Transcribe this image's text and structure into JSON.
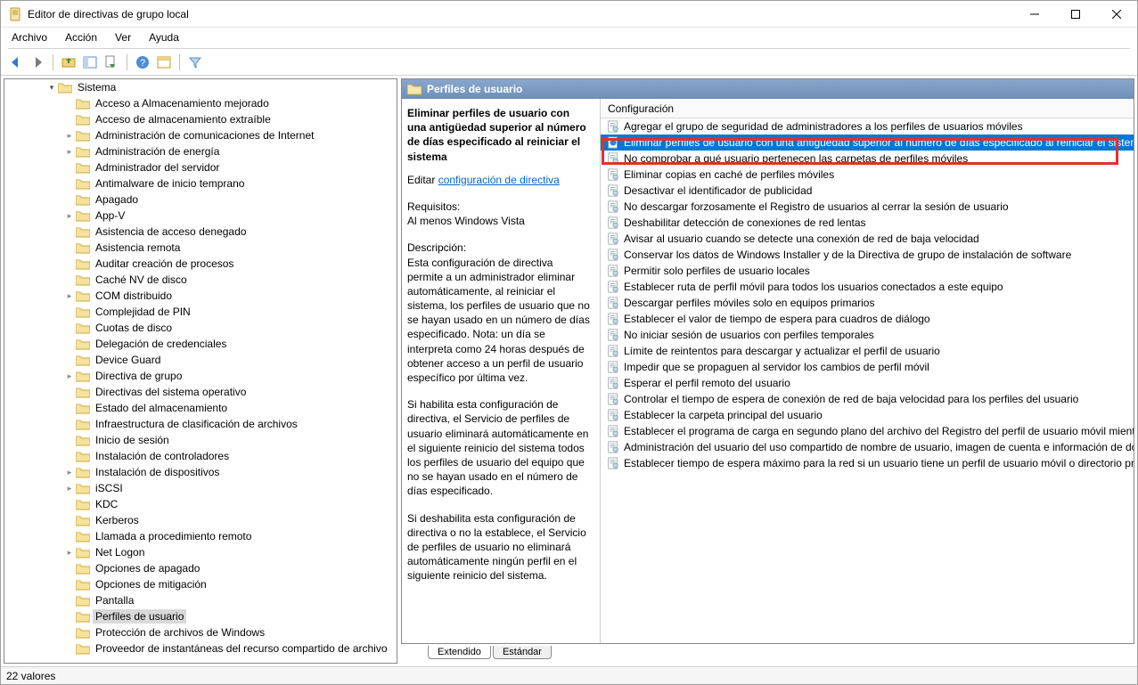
{
  "window": {
    "title": "Editor de directivas de grupo local"
  },
  "menus": [
    "Archivo",
    "Acción",
    "Ver",
    "Ayuda"
  ],
  "tree": {
    "root_label": "Sistema",
    "items": [
      {
        "label": "Acceso a Almacenamiento mejorado",
        "arrow": "none"
      },
      {
        "label": "Acceso de almacenamiento extraíble",
        "arrow": "none"
      },
      {
        "label": "Administración de comunicaciones de Internet",
        "arrow": "right"
      },
      {
        "label": "Administración de energía",
        "arrow": "right"
      },
      {
        "label": "Administrador del servidor",
        "arrow": "none"
      },
      {
        "label": "Antimalware de inicio temprano",
        "arrow": "none"
      },
      {
        "label": "Apagado",
        "arrow": "none"
      },
      {
        "label": "App-V",
        "arrow": "right"
      },
      {
        "label": "Asistencia de acceso denegado",
        "arrow": "none"
      },
      {
        "label": "Asistencia remota",
        "arrow": "none"
      },
      {
        "label": "Auditar creación de procesos",
        "arrow": "none"
      },
      {
        "label": "Caché NV de disco",
        "arrow": "none"
      },
      {
        "label": "COM distribuido",
        "arrow": "right"
      },
      {
        "label": "Complejidad de PIN",
        "arrow": "none"
      },
      {
        "label": "Cuotas de disco",
        "arrow": "none"
      },
      {
        "label": "Delegación de credenciales",
        "arrow": "none"
      },
      {
        "label": "Device Guard",
        "arrow": "none"
      },
      {
        "label": "Directiva de grupo",
        "arrow": "right"
      },
      {
        "label": "Directivas del sistema operativo",
        "arrow": "none"
      },
      {
        "label": "Estado del almacenamiento",
        "arrow": "none"
      },
      {
        "label": "Infraestructura de clasificación de archivos",
        "arrow": "none"
      },
      {
        "label": "Inicio de sesión",
        "arrow": "none"
      },
      {
        "label": "Instalación de controladores",
        "arrow": "none"
      },
      {
        "label": "Instalación de dispositivos",
        "arrow": "right"
      },
      {
        "label": "iSCSI",
        "arrow": "right"
      },
      {
        "label": "KDC",
        "arrow": "none"
      },
      {
        "label": "Kerberos",
        "arrow": "none"
      },
      {
        "label": "Llamada a procedimiento remoto",
        "arrow": "none"
      },
      {
        "label": "Net Logon",
        "arrow": "right"
      },
      {
        "label": "Opciones de apagado",
        "arrow": "none"
      },
      {
        "label": "Opciones de mitigación",
        "arrow": "none"
      },
      {
        "label": "Pantalla",
        "arrow": "none"
      },
      {
        "label": "Perfiles de usuario",
        "arrow": "none",
        "selected": true
      },
      {
        "label": "Protección de archivos de Windows",
        "arrow": "none"
      },
      {
        "label": "Proveedor de instantáneas del recurso compartido de archivo",
        "arrow": "none"
      }
    ]
  },
  "right": {
    "header": "Perfiles de usuario",
    "detail_title": "Eliminar perfiles de usuario con una antigüedad superior al número de días especificado al reiniciar el sistema",
    "edit_label": "Editar",
    "edit_link": "configuración de directiva",
    "req_label": "Requisitos:",
    "req_text": "Al menos Windows Vista",
    "desc_label": "Descripción:",
    "desc_p1": "Esta configuración de directiva permite a un administrador eliminar automáticamente, al reiniciar el sistema, los perfiles de usuario que no se hayan usado en un número de días especificado. Nota: un día se interpreta como 24 horas después de obtener acceso a un perfil de usuario específico por última vez.",
    "desc_p2": "Si habilita esta configuración de directiva, el Servicio de perfiles de usuario eliminará automáticamente en el siguiente reinicio del sistema todos los perfiles de usuario del equipo que no se hayan usado en el número de días especificado.",
    "desc_p3": "Si deshabilita esta configuración de directiva o no la establece, el Servicio de perfiles de usuario no eliminará automáticamente ningún perfil en el siguiente reinicio del sistema.",
    "list_header": "Configuración",
    "settings": [
      "Agregar el grupo de seguridad de administradores a los perfiles de usuarios móviles",
      "Eliminar perfiles de usuario con una antigüedad superior al número de días especificado al reiniciar el sistema",
      "No comprobar a qué usuario pertenecen las carpetas de perfiles móviles",
      "Eliminar copias en caché de perfiles móviles",
      "Desactivar el identificador de publicidad",
      "No descargar forzosamente el Registro de usuarios al cerrar la sesión de usuario",
      "Deshabilitar detección de conexiones de red lentas",
      "Avisar al usuario cuando se detecte una conexión de red de baja velocidad",
      "Conservar los datos de Windows Installer y de la Directiva de grupo de instalación de software",
      "Permitir solo perfiles de usuario locales",
      "Establecer ruta de perfil móvil para todos los usuarios conectados a este equipo",
      "Descargar perfiles móviles solo en equipos primarios",
      "Establecer el valor de tiempo de espera para cuadros de diálogo",
      "No iniciar sesión de usuarios con perfiles temporales",
      "Límite de reintentos para descargar y actualizar el perfil de usuario",
      "Impedir que se propaguen al servidor los cambios de perfil móvil",
      "Esperar el perfil remoto del usuario",
      "Controlar el tiempo de espera de conexión de red de baja velocidad para los perfiles del usuario",
      "Establecer la carpeta principal del usuario",
      "Establecer el programa de carga en segundo plano del archivo del Registro del perfil de usuario móvil mientras el",
      "Administración del usuario del uso compartido de nombre de usuario, imagen de cuenta e información de domin",
      "Establecer tiempo de espera máximo para la red si un usuario tiene un perfil de usuario móvil o directorio princip"
    ],
    "selected_index": 1
  },
  "tabs": {
    "extended": "Extendido",
    "standard": "Estándar"
  },
  "status": "22 valores"
}
